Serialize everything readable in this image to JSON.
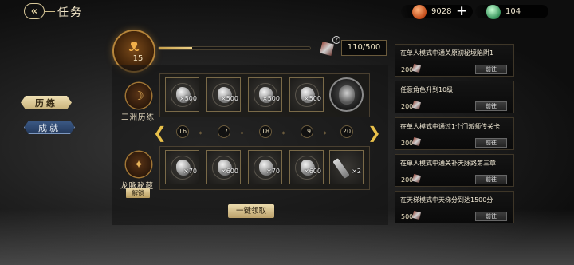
{
  "header": {
    "back_icon": "back-arrow-icon",
    "title": "任务"
  },
  "resources": {
    "gold": {
      "icon": "orange-gem-icon",
      "value": "9028"
    },
    "plus": "+",
    "jade": {
      "icon": "jade-icon",
      "value": "104"
    }
  },
  "tabs": [
    {
      "label": "历练",
      "active": true
    },
    {
      "label": "成就",
      "active": false
    }
  ],
  "progress": {
    "level": "15",
    "emblem_icon": "flame-emblem-icon",
    "help": "?",
    "text": "110/500",
    "fraction": 0.22
  },
  "tracks": [
    {
      "label": "三洲历练",
      "icon": "moon-emblem-icon"
    },
    {
      "label": "龙脉秘藏",
      "icon": "dragon-emblem-icon",
      "unlock": "解锁"
    }
  ],
  "free_rewards": [
    {
      "qty": "×500"
    },
    {
      "qty": "×500"
    },
    {
      "qty": "×500"
    },
    {
      "qty": "×500"
    },
    {
      "qty": ""
    }
  ],
  "premium_rewards": [
    {
      "qty": "×70"
    },
    {
      "qty": "×600"
    },
    {
      "qty": "×70"
    },
    {
      "qty": "×600"
    },
    {
      "qty": "×2"
    }
  ],
  "levels": [
    "16",
    "17",
    "18",
    "19",
    "20"
  ],
  "arrows": {
    "left": "❮",
    "right": "❯"
  },
  "claim_all": "一键领取",
  "quests": [
    {
      "title": "在单人模式中通关原初秘境陷阱1",
      "reward": "200",
      "button": "前往"
    },
    {
      "title": "任意角色升到10级",
      "reward": "200",
      "button": "前往"
    },
    {
      "title": "在单人模式中通过1个门派师传关卡",
      "reward": "200",
      "button": "前往"
    },
    {
      "title": "在单人模式中通关补天脉路第三章",
      "reward": "200",
      "button": "前往"
    },
    {
      "title": "在天梯模式中天梯分到达1500分",
      "reward": "500",
      "button": "前往"
    }
  ]
}
